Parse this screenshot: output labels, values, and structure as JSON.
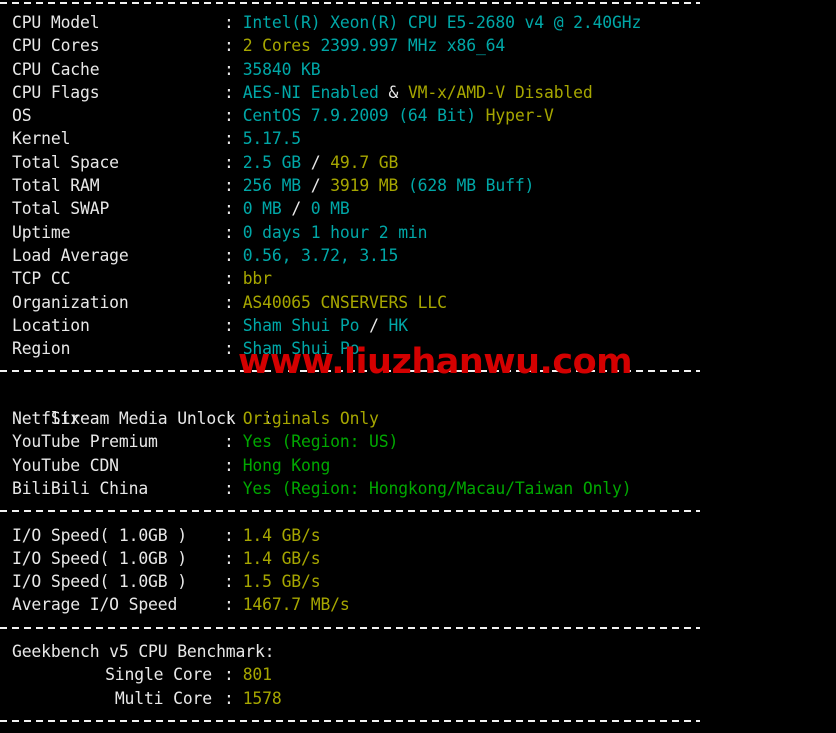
{
  "terminal": {
    "colors": {
      "background": "#000000",
      "label": "#e8e8e8",
      "cyan": "#00a7a7",
      "yellow": "#a6a600",
      "green": "#00a800",
      "watermark_red": "#d40000",
      "separator": "#f2f2f2"
    },
    "separator_char": "-"
  },
  "watermark": {
    "text": "www.liuzhanwu.com"
  },
  "system_info": {
    "rows": [
      {
        "label": "CPU Model",
        "separator": ":",
        "segments": [
          {
            "text": "Intel(R) Xeon(R) CPU E5-2680 v4 @ 2.40GHz",
            "color": "cyan"
          }
        ]
      },
      {
        "label": "CPU Cores",
        "separator": ":",
        "segments": [
          {
            "text": "2 Cores ",
            "color": "yellow"
          },
          {
            "text": "2399.997 MHz x86_64",
            "color": "cyan"
          }
        ]
      },
      {
        "label": "CPU Cache",
        "separator": ":",
        "segments": [
          {
            "text": "35840 KB",
            "color": "cyan"
          }
        ]
      },
      {
        "label": "CPU Flags",
        "separator": ":",
        "segments": [
          {
            "text": "AES-NI Enabled ",
            "color": "cyan"
          },
          {
            "text": "& ",
            "color": "white"
          },
          {
            "text": "VM-x/AMD-V Disabled",
            "color": "yellow"
          }
        ]
      },
      {
        "label": "OS",
        "separator": ":",
        "segments": [
          {
            "text": "CentOS 7.9.2009 (64 Bit) ",
            "color": "cyan"
          },
          {
            "text": "Hyper-V",
            "color": "yellow"
          }
        ]
      },
      {
        "label": "Kernel",
        "separator": ":",
        "segments": [
          {
            "text": "5.17.5",
            "color": "cyan"
          }
        ]
      },
      {
        "label": "Total Space",
        "separator": ":",
        "segments": [
          {
            "text": "2.5 GB ",
            "color": "cyan"
          },
          {
            "text": "/ ",
            "color": "white"
          },
          {
            "text": "49.7 GB",
            "color": "yellow"
          }
        ]
      },
      {
        "label": "Total RAM",
        "separator": ":",
        "segments": [
          {
            "text": "256 MB ",
            "color": "cyan"
          },
          {
            "text": "/ ",
            "color": "white"
          },
          {
            "text": "3919 MB ",
            "color": "yellow"
          },
          {
            "text": "(628 MB Buff)",
            "color": "cyan"
          }
        ]
      },
      {
        "label": "Total SWAP",
        "separator": ":",
        "segments": [
          {
            "text": "0 MB ",
            "color": "cyan"
          },
          {
            "text": "/ ",
            "color": "white"
          },
          {
            "text": "0 MB",
            "color": "cyan"
          }
        ]
      },
      {
        "label": "Uptime",
        "separator": ":",
        "segments": [
          {
            "text": "0 days 1 hour 2 min",
            "color": "cyan"
          }
        ]
      },
      {
        "label": "Load Average",
        "separator": ":",
        "segments": [
          {
            "text": "0.56, 3.72, 3.15",
            "color": "cyan"
          }
        ]
      },
      {
        "label": "TCP CC",
        "separator": ":",
        "segments": [
          {
            "text": "bbr",
            "color": "yellow"
          }
        ]
      },
      {
        "label": "Organization",
        "separator": ":",
        "segments": [
          {
            "text": "AS40065 CNSERVERS LLC",
            "color": "yellow"
          }
        ]
      },
      {
        "label": "Location",
        "separator": ":",
        "segments": [
          {
            "text": "Sham Shui Po ",
            "color": "cyan"
          },
          {
            "text": "/ ",
            "color": "white"
          },
          {
            "text": "HK",
            "color": "cyan"
          }
        ]
      },
      {
        "label": "Region",
        "separator": ":",
        "segments": [
          {
            "text": "Sham Shui Po",
            "color": "cyan"
          }
        ]
      }
    ]
  },
  "stream_media": {
    "heading": {
      "label": "Stream Media Unlock",
      "separator": ":"
    },
    "rows": [
      {
        "label": "Netflix",
        "separator": ":",
        "segments": [
          {
            "text": "Originals Only",
            "color": "yellow"
          }
        ]
      },
      {
        "label": "YouTube Premium",
        "separator": ":",
        "segments": [
          {
            "text": "Yes (Region: US)",
            "color": "green"
          }
        ]
      },
      {
        "label": "YouTube CDN",
        "separator": ":",
        "segments": [
          {
            "text": "Hong Kong",
            "color": "green"
          }
        ]
      },
      {
        "label": "BiliBili China",
        "separator": ":",
        "segments": [
          {
            "text": "Yes (Region: Hongkong/Macau/Taiwan Only)",
            "color": "green"
          }
        ]
      }
    ]
  },
  "io_speed": {
    "rows": [
      {
        "label": "I/O Speed( 1.0GB )",
        "separator": ":",
        "segments": [
          {
            "text": "1.4 GB/s",
            "color": "yellow"
          }
        ]
      },
      {
        "label": "I/O Speed( 1.0GB )",
        "separator": ":",
        "segments": [
          {
            "text": "1.4 GB/s",
            "color": "yellow"
          }
        ]
      },
      {
        "label": "I/O Speed( 1.0GB )",
        "separator": ":",
        "segments": [
          {
            "text": "1.5 GB/s",
            "color": "yellow"
          }
        ]
      },
      {
        "label": "Average I/O Speed",
        "separator": ":",
        "segments": [
          {
            "text": "1467.7 MB/s",
            "color": "yellow"
          }
        ]
      }
    ]
  },
  "geekbench": {
    "heading": "Geekbench v5 CPU Benchmark:",
    "rows": [
      {
        "label": "Single Core",
        "separator": ":",
        "segments": [
          {
            "text": "801",
            "color": "yellow"
          }
        ]
      },
      {
        "label": "Multi Core",
        "separator": ":",
        "segments": [
          {
            "text": "1578",
            "color": "yellow"
          }
        ]
      }
    ]
  }
}
